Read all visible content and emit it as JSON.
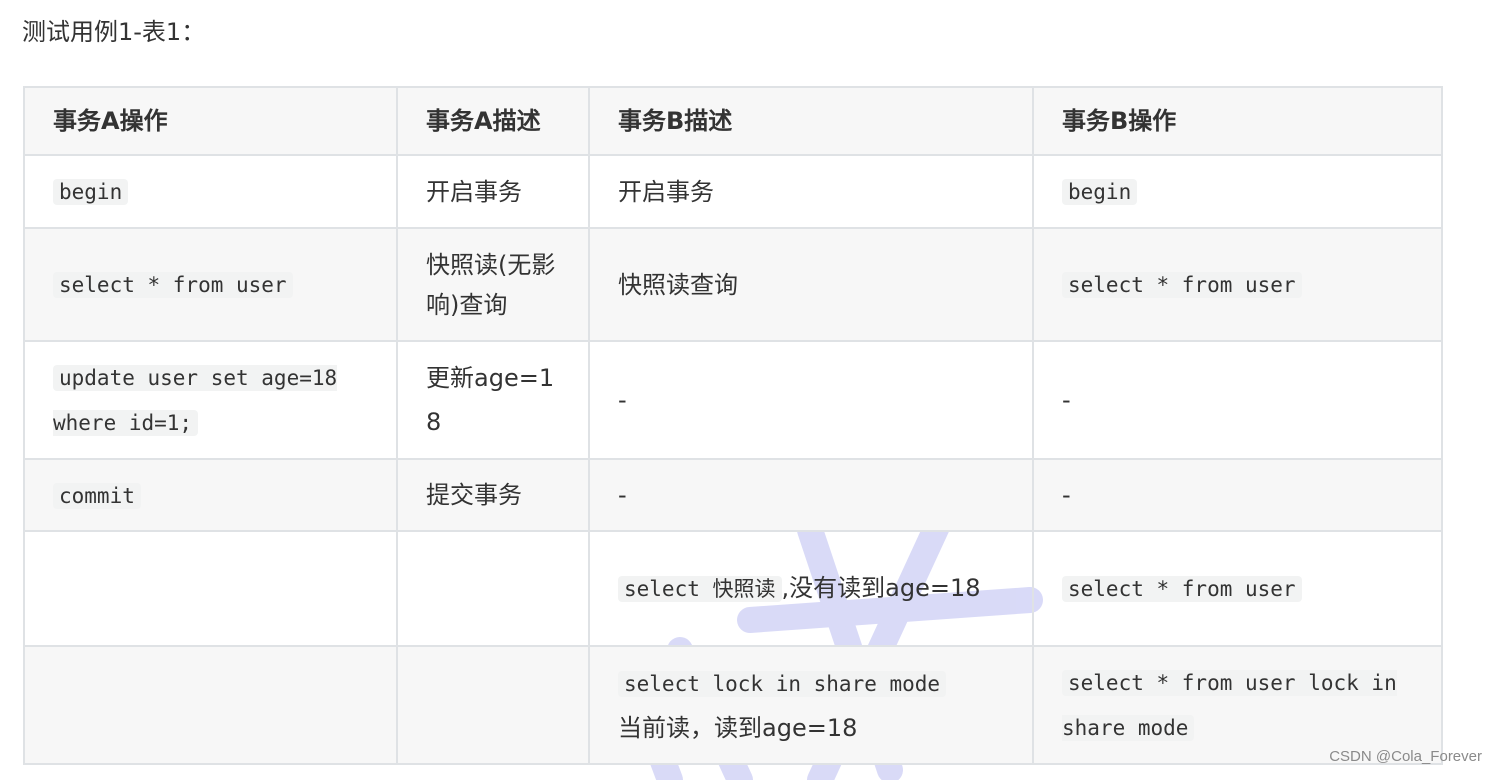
{
  "caption": "测试用例1-表1：",
  "table": {
    "headers": [
      "事务A操作",
      "事务A描述",
      "事务B描述",
      "事务B操作"
    ],
    "rows": [
      {
        "a_op": "begin",
        "a_desc": "开启事务",
        "b_desc": "开启事务",
        "b_op": "begin"
      },
      {
        "a_op": "select * from user",
        "a_desc": "快照读(无影响)查询",
        "b_desc": "快照读查询",
        "b_op": "select * from user"
      },
      {
        "a_op": "update user set age=18 where id=1;",
        "a_desc": "更新age=18",
        "b_desc": "-",
        "b_op": "-"
      },
      {
        "a_op": "commit",
        "a_desc": "提交事务",
        "b_desc": "-",
        "b_op": "-"
      },
      {
        "a_op": "",
        "a_desc": "",
        "b_desc_code": "select 快照读",
        "b_desc": ",没有读到age=18",
        "b_op": "select * from user"
      },
      {
        "a_op": "",
        "a_desc": "",
        "b_desc_code": "select lock in share mode",
        "b_desc": "当前读，读到age=18",
        "b_op": "select * from user lock in share mode"
      }
    ]
  },
  "credit": "CSDN @Cola_Forever",
  "colors": {
    "border": "#dfe2e5",
    "header_bg": "#f7f7f7",
    "watermark": "#c9cbf5"
  }
}
